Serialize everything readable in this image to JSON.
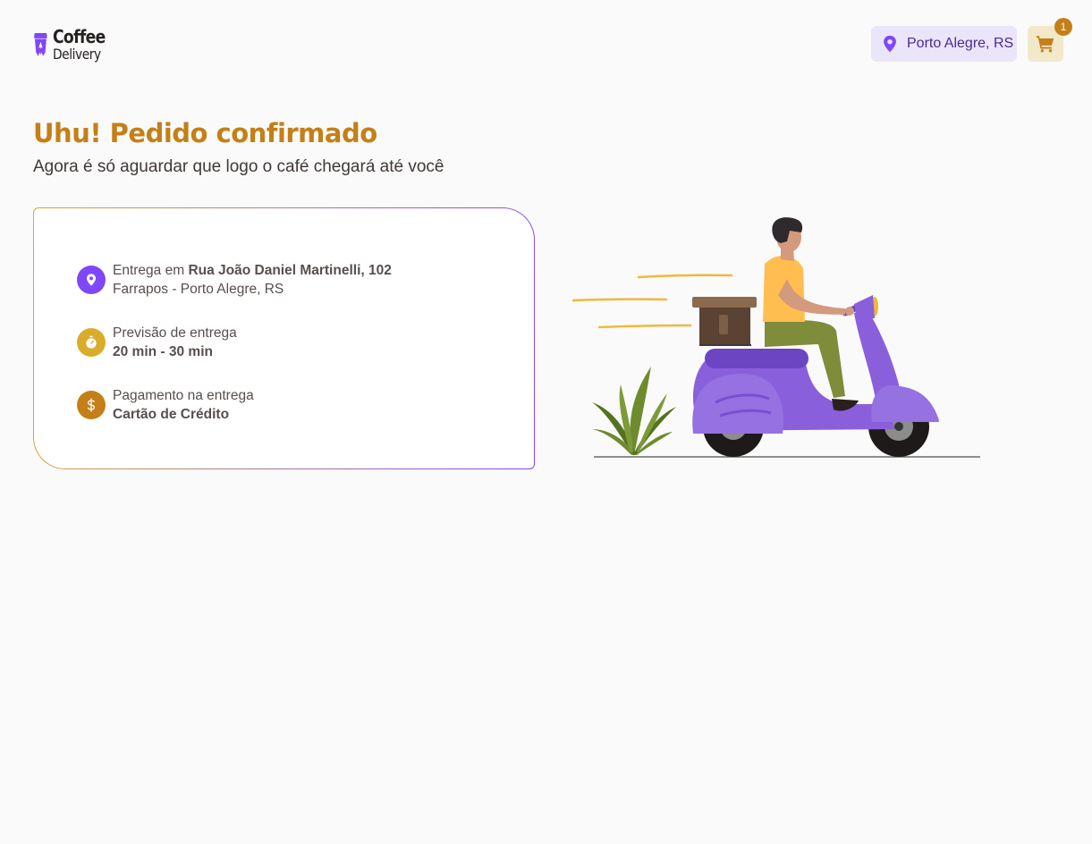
{
  "header": {
    "logo": {
      "title": "Coffee",
      "subtitle": "Delivery",
      "color": "#8047F8"
    },
    "location": {
      "icon": "map-pin-icon",
      "label": "Porto Alegre, RS"
    },
    "cart": {
      "icon": "shopping-cart-icon",
      "count": "1"
    }
  },
  "confirmation": {
    "title": "Uhu! Pedido confirmado",
    "subtitle": "Agora é só aguardar que logo o café chegará até você"
  },
  "order_info": {
    "address": {
      "icon": "map-pin-icon",
      "icon_color": "#8047F8",
      "prefix": "Entrega em ",
      "street": "Rua João Daniel Martinelli, 102",
      "detail": "Farrapos - Porto Alegre, RS"
    },
    "delivery_time": {
      "icon": "timer-icon",
      "icon_color": "#DBAC2C",
      "label": "Previsão de entrega",
      "value": "20 min - 30 min"
    },
    "payment": {
      "icon": "currency-dollar-icon",
      "icon_color": "#C47F17",
      "label": "Pagamento na entrega",
      "value": "Cartão de Crédito"
    }
  },
  "illustration": {
    "icon": "delivery-scooter-illustration"
  },
  "colors": {
    "background": "#FAFAFA",
    "yellow_dark": "#C47F17",
    "yellow": "#DBAC2C",
    "yellow_light": "#F1E9C9",
    "purple": "#8047F8",
    "purple_dark": "#4B2995",
    "purple_light": "#EBE5F9"
  }
}
